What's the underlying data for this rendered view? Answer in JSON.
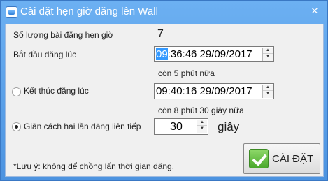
{
  "window": {
    "title": "Cài đặt hẹn giờ đăng lên Wall",
    "close_symbol": "✕"
  },
  "form": {
    "post_count_label": "Số lượng bài đăng hẹn giờ",
    "post_count_value": "7",
    "start_label": "Bắt đầu đăng lúc",
    "start_hour": "09",
    "start_rest": ":36:46 29/09/2017",
    "start_note": "còn 5 phút nữa",
    "end_label": "Kết thúc đăng lúc",
    "end_value": "09:40:16 29/09/2017",
    "end_note": "còn 8 phút 30 giây nữa",
    "interval_label": "Giãn cách hai lần đăng liên tiếp",
    "interval_value": "30",
    "interval_unit": "giây",
    "end_radio_selected": false,
    "interval_radio_selected": true
  },
  "footer": {
    "note": "*Lưu ý: không để chồng lấn thời gian đăng.",
    "set_button_label": "CÀI ĐẶT"
  },
  "icons": {
    "app": "app-icon",
    "close": "close-icon",
    "check": "check-icon",
    "spin_up": "spin-up-icon",
    "spin_down": "spin-down-icon"
  },
  "colors": {
    "title_bar": "#5aa0e6",
    "selection": "#3399ff",
    "check_green": "#4aa82c"
  }
}
